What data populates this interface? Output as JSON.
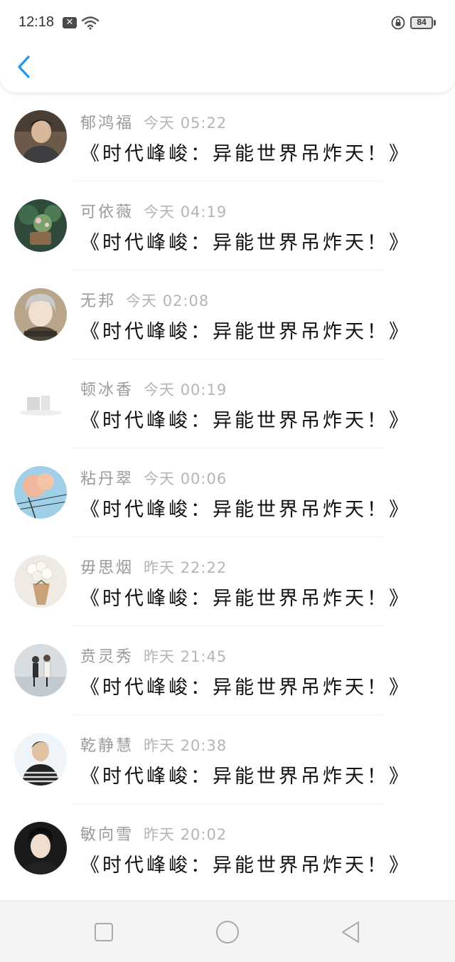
{
  "status_bar": {
    "time": "12:18",
    "notification_glyph": "✕",
    "battery": "84",
    "icons": [
      "notification-icon",
      "wifi-icon",
      "lock-rotation-icon",
      "battery-icon"
    ]
  },
  "header": {
    "back_icon": "chevron-left-icon",
    "accent_color": "#2196F3"
  },
  "messages": [
    {
      "name": "郁鸿福",
      "time": "今天 05:22",
      "text": "《时代峰峻：异能世界吊炸天！》"
    },
    {
      "name": "可依薇",
      "time": "今天 04:19",
      "text": "《时代峰峻：异能世界吊炸天！》"
    },
    {
      "name": "无邦",
      "time": "今天 02:08",
      "text": "《时代峰峻：异能世界吊炸天！》"
    },
    {
      "name": "顿冰香",
      "time": "今天 00:19",
      "text": "《时代峰峻：异能世界吊炸天！》"
    },
    {
      "name": "粘丹翠",
      "time": "今天 00:06",
      "text": "《时代峰峻：异能世界吊炸天！》"
    },
    {
      "name": "毋思烟",
      "time": "昨天 22:22",
      "text": "《时代峰峻：异能世界吊炸天！》"
    },
    {
      "name": "贲灵秀",
      "time": "昨天 21:45",
      "text": "《时代峰峻：异能世界吊炸天！》"
    },
    {
      "name": "乾静慧",
      "time": "昨天 20:38",
      "text": "《时代峰峻：异能世界吊炸天！》"
    },
    {
      "name": "敏向雪",
      "time": "昨天 20:02",
      "text": "《时代峰峻：异能世界吊炸天！》"
    }
  ],
  "nav_bar": {
    "icons": [
      "recent-apps-icon",
      "home-icon",
      "back-icon"
    ]
  }
}
